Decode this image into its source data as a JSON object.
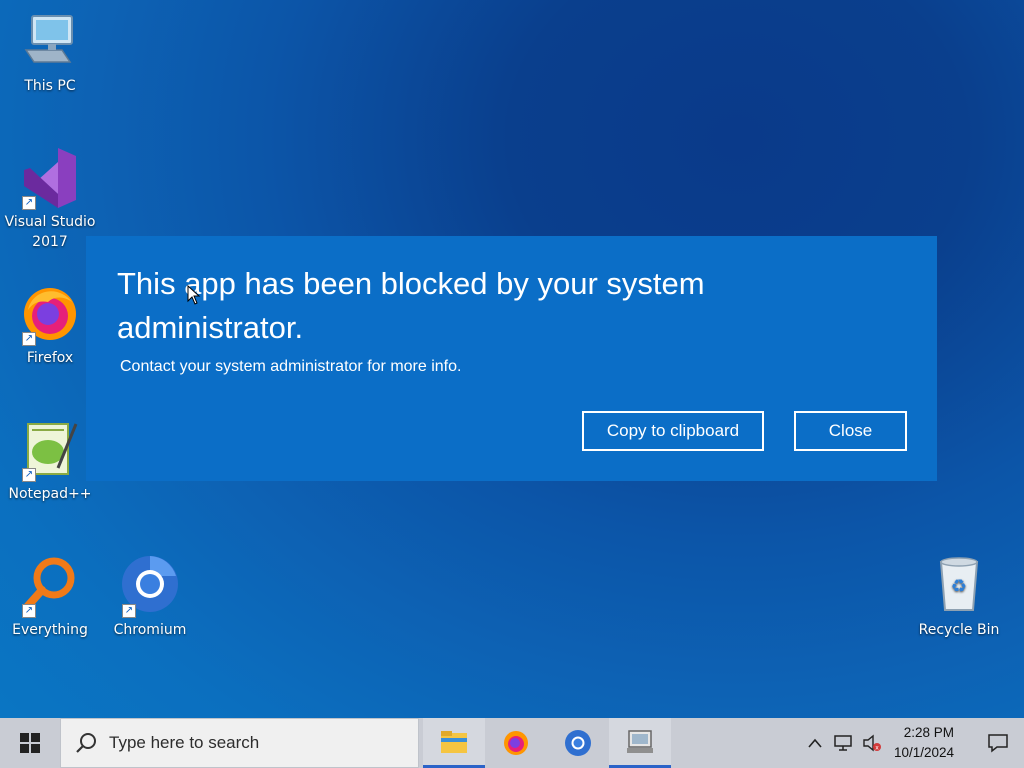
{
  "desktop": {
    "icons": [
      {
        "label": "This PC",
        "icon": "computer-icon"
      },
      {
        "label": "Visual Studio 2017",
        "icon": "visual-studio-icon"
      },
      {
        "label": "Firefox",
        "icon": "firefox-icon"
      },
      {
        "label": "Notepad++",
        "icon": "notepadpp-icon"
      },
      {
        "label": "Everything",
        "icon": "everything-search-icon"
      },
      {
        "label": "Chromium",
        "icon": "chromium-icon"
      },
      {
        "label": "Recycle Bin",
        "icon": "recycle-bin-icon"
      }
    ]
  },
  "dialog": {
    "title": "This app has been blocked by your system administrator.",
    "subtitle": "Contact your system administrator for more info.",
    "copy_label": "Copy to clipboard",
    "close_label": "Close",
    "bg_color": "#0b6ec7"
  },
  "taskbar": {
    "search_placeholder": "Type here to search",
    "apps": [
      {
        "name": "File Explorer",
        "icon": "file-explorer-icon"
      },
      {
        "name": "Firefox",
        "icon": "firefox-icon"
      },
      {
        "name": "Chromium",
        "icon": "chromium-icon"
      },
      {
        "name": "Blocked App",
        "icon": "blocked-app-icon"
      }
    ],
    "clock_time": "2:28 PM",
    "clock_date": "10/1/2024"
  }
}
